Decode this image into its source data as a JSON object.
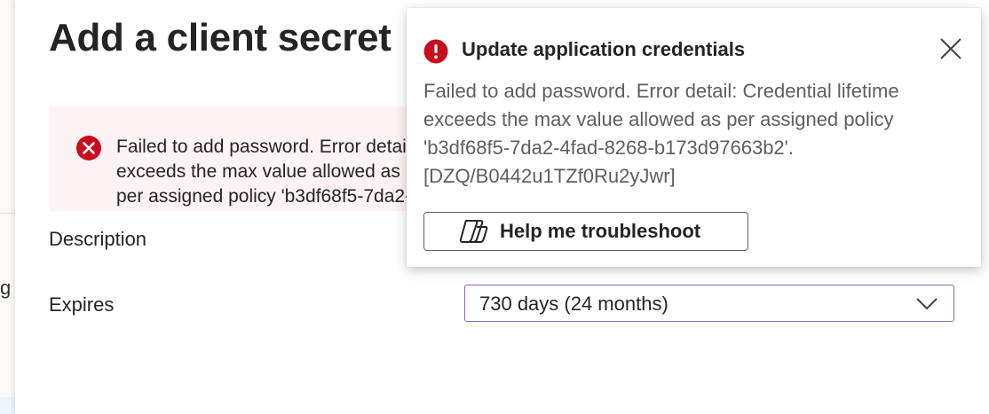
{
  "left_edge": {
    "glyph": "g"
  },
  "panel": {
    "title": "Add a client secret",
    "error_banner": {
      "icon": "error-circle-icon",
      "message": "Failed to add password. Error detail: Credential lifetime exceeds the max value allowed as\nper assigned policy 'b3df68f5-7da2-4fad-8268-b173d97663b2'."
    },
    "form": {
      "description_label": "Description",
      "expires_label": "Expires",
      "expires_value": "730 days (24 months)"
    }
  },
  "notification": {
    "icon": "error-icon",
    "title": "Update application credentials",
    "message": "Failed to add password. Error detail: Credential lifetime exceeds the max value allowed as per assigned policy 'b3df68f5-7da2-4fad-8268-b173d97663b2'. [DZQ/B0442u1TZf0Ru2yJwr]",
    "button_label": "Help me troubleshoot",
    "button_icon": "copilot-icon",
    "close_icon": "close-icon"
  },
  "colors": {
    "error_red": "#c50f1f",
    "banner_bg": "#fdf3f4",
    "select_border": "#8764b8",
    "body_text": "#242424",
    "secondary_text": "#605e5c"
  }
}
